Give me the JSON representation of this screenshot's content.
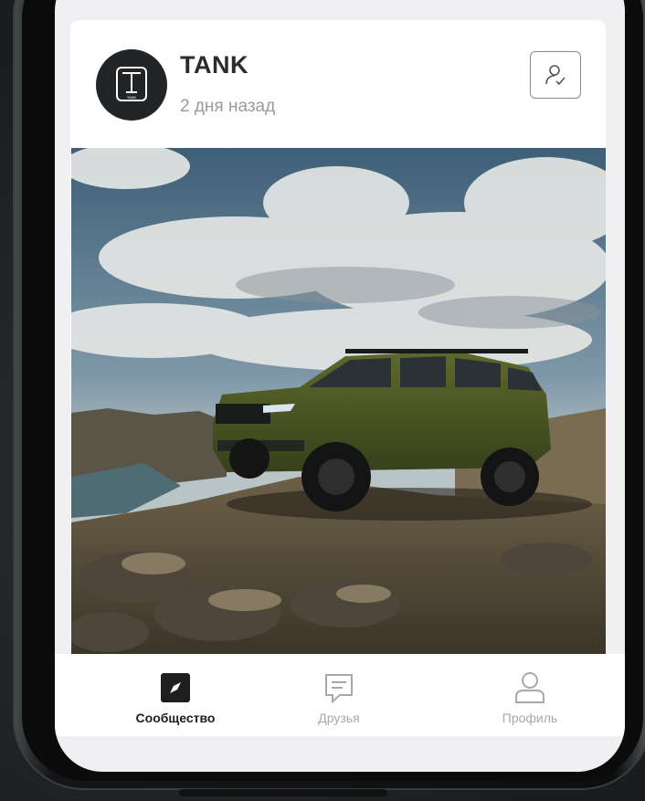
{
  "post": {
    "author": "TANK",
    "logo_text": "TANK",
    "time": "2 дня назад",
    "follow_icon": "user-check-icon",
    "image_alt": "green-suv-on-rocky-cliff"
  },
  "tabbar": {
    "tabs": [
      {
        "label": "Сообщество",
        "icon": "compass-icon",
        "active": true
      },
      {
        "label": "Друзья",
        "icon": "chat-icon",
        "active": false
      },
      {
        "label": "Профиль",
        "icon": "person-icon",
        "active": false
      }
    ]
  },
  "colors": {
    "accent": "#1e1e1e",
    "inactive": "#a8a8a8",
    "card": "#ffffff",
    "screen": "#f0f0f2"
  }
}
